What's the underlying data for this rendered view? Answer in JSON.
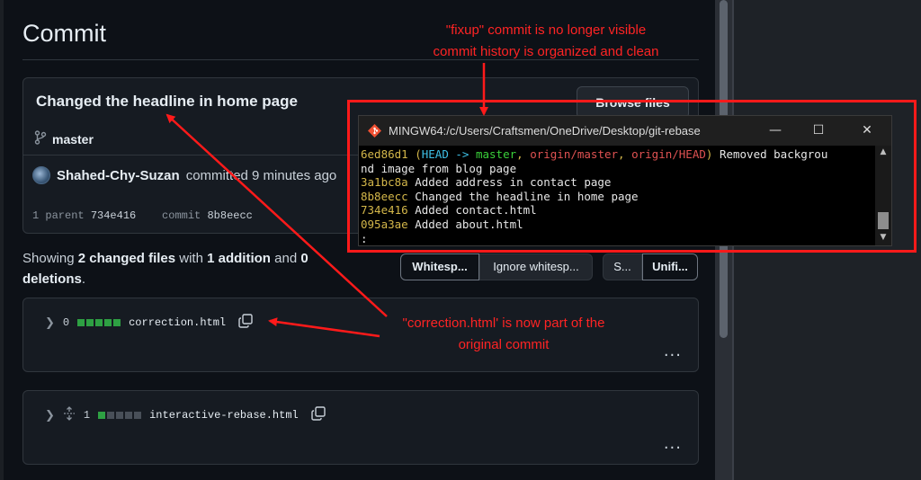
{
  "github": {
    "page_title": "Commit",
    "commit_headline": "Changed the headline in home page",
    "browse_files_label": "Browse files",
    "branch": "master",
    "author": "Shahed-Chy-Suzan",
    "committed_text": "committed 9 minutes ago",
    "parent_label": "1 parent",
    "parent_hash": "734e416",
    "commit_label": "commit",
    "commit_hash": "8b8eecc",
    "summary": {
      "showing": "Showing",
      "changed_files": "2 changed files",
      "with": "with",
      "additions": "1 addition",
      "and": "and",
      "deletions": "0 deletions",
      "period": "."
    },
    "buttons": {
      "whitespace": "Whitesp...",
      "ignore_whitespace": "Ignore whitesp...",
      "split": "S...",
      "unified": "Unifi..."
    },
    "files": [
      {
        "count": "0",
        "name": "correction.html",
        "blocks": [
          "add",
          "add",
          "add",
          "add",
          "add"
        ]
      },
      {
        "count": "1",
        "name": "interactive-rebase.html",
        "blocks": [
          "add",
          "off",
          "off",
          "off",
          "off"
        ]
      }
    ],
    "more_label": "..."
  },
  "terminal": {
    "title": "MINGW64:/c/Users/Craftsmen/OneDrive/Desktop/git-rebase",
    "minimize": "—",
    "maximize": "☐",
    "close": "✕",
    "lines": [
      {
        "hash": "6ed86d1",
        "open": " (",
        "head": "HEAD -> ",
        "branch": "master",
        "sep1": ", ",
        "remote1": "origin/master",
        "sep2": ", ",
        "remote2": "origin/HEAD",
        "close": ")",
        "msg": " Removed backgrou"
      },
      {
        "hash": "",
        "msg": "nd image from blog page"
      },
      {
        "hash": "3a1bc8a",
        "msg": " Added address in contact page"
      },
      {
        "hash": "8b8eecc",
        "msg": " Changed the headline in home page"
      },
      {
        "hash": "734e416",
        "msg": " Added contact.html"
      },
      {
        "hash": "095a3ae",
        "msg": " Added about.html"
      },
      {
        "hash": "",
        "msg": ":"
      }
    ]
  },
  "annotations": {
    "top_line1": "\"fixup\" commit is no longer visible",
    "top_line2": "commit history is organized and clean",
    "mid_line1": "\"correction.html' is now part of the",
    "mid_line2": "original commit"
  },
  "colors": {
    "annotation_red": "#ff1a1a",
    "diff_green": "#2ea043",
    "terminal_hash": "#d4b74a",
    "terminal_head": "#3ec0e6",
    "terminal_branch": "#3ad13a",
    "terminal_remote": "#e05252"
  }
}
